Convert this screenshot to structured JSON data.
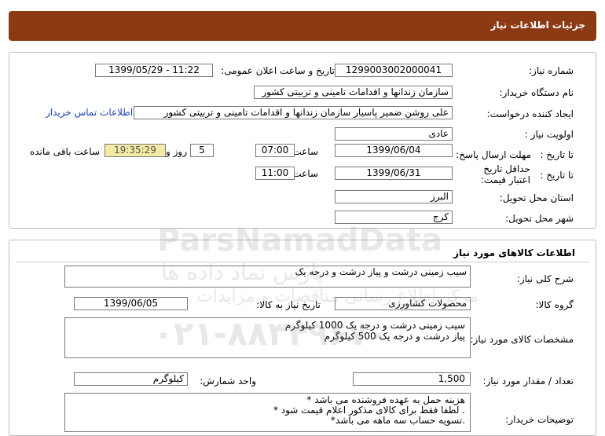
{
  "header": {
    "title": "جزئیات اطلاعات نیاز"
  },
  "info": {
    "need_number_label": "شماره نیاز:",
    "need_number": "1299003002000041",
    "announce_label": "تاریخ و ساعت اعلان عمومی:",
    "announce_value": "1399/05/29 - 11:22",
    "buyer_label": "نام دستگاه خریدار:",
    "buyer_value": "سازمان زندانها و اقدامات تامینی و تربیتی کشور",
    "creator_label": "ایجاد کننده درخواست:",
    "creator_value": "علی روشن ضمیر پاسیار سازمان زندانها و اقدامات تامینی و تربیتی کشور",
    "contact_link": "اطلاعات تماس خریدار",
    "priority_label": "اولویت نیاز :",
    "priority_value": "عادی",
    "deadline_label": "مهلت ارسال پاسخ:",
    "until_date_label": "تا تاریخ :",
    "deadline_date": "1399/06/04",
    "hour_label": "ساعت",
    "deadline_time": "07:00",
    "days_value": "5",
    "days_label": "روز و",
    "remaining_time": "19:35:29",
    "remaining_label": "ساعت باقی مانده",
    "validity_label": "حداقل تاریخ اعتبار قیمت:",
    "validity_date": "1399/06/31",
    "validity_time": "11:00",
    "province_label": "استان محل تحویل:",
    "province_value": "البرز",
    "city_label": "شهر محل تحویل:",
    "city_value": "کرج"
  },
  "goods": {
    "title": "اطلاعات کالاهای مورد نیاز",
    "summary_label": "شرح کلی نیاز:",
    "summary_value": "سیب زمینی درشت و پیاز درشت و درجه یک",
    "group_label": "گروه کالا:",
    "group_value": "محصولات کشاورزی",
    "need_date_label": "تاریخ نیاز به کالا:",
    "need_date_value": "1399/06/05",
    "spec_label": "مشخصات کالای مورد نیاز:",
    "spec_lines": [
      "سیب زمینی درشت و درجه یک 1000 کیلوگرم",
      "پیاز درشت و درجه یک 500 کیلوگرم"
    ],
    "qty_label": "تعداد / مقدار مورد نیاز:",
    "qty_value": "1,500",
    "unit_label": "واحد شمارش:",
    "unit_value": "کیلوگرم",
    "notes_label": "توضیحات خریدار:",
    "notes_lines": [
      "هزینه حمل به عهده فروشنده می باشد *",
      ". لطفا فقط برای کالای مذکور اعلام قیمت شود *",
      ".تسویه حساب سه ماهه می باشد*"
    ]
  },
  "watermark": {
    "brand": "ParsNamadData",
    "persian": "پارس نماد داده ها",
    "sub": "مرکز اطلاع رسانی مناقصات و مزایدات",
    "phone": "۰۲۱-۸۸۳۴۹۶۷۰"
  }
}
